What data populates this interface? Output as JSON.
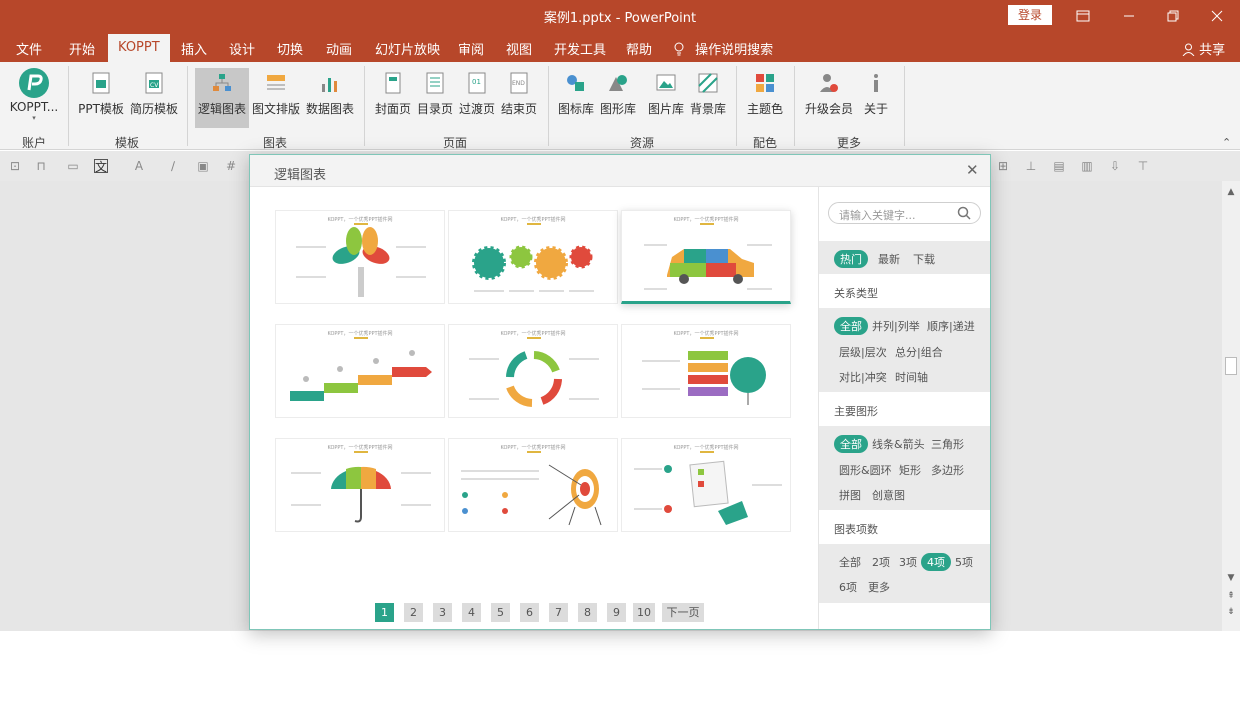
{
  "window": {
    "title": "案例1.pptx  -  PowerPoint",
    "login": "登录"
  },
  "menu": {
    "items": [
      "文件",
      "开始",
      "KOPPT",
      "插入",
      "设计",
      "切换",
      "动画",
      "幻灯片放映",
      "审阅",
      "视图",
      "开发工具",
      "帮助"
    ],
    "tell_me": "操作说明搜索",
    "share": "共享"
  },
  "ribbon": {
    "buttons": [
      "KOPPT...",
      "PPT模板",
      "简历模板",
      "逻辑图表",
      "图文排版",
      "数据图表",
      "封面页",
      "目录页",
      "过渡页",
      "结束页",
      "图标库",
      "图形库",
      "图片库",
      "背景库",
      "主题色",
      "升级会员",
      "关于"
    ],
    "groups": [
      "账户",
      "模板",
      "图表",
      "页面",
      "资源",
      "配色",
      "更多"
    ]
  },
  "dialog": {
    "title": "逻辑图表",
    "card_caption": "KOPPT，一个优秀PPT插件网",
    "pager": [
      "1",
      "2",
      "3",
      "4",
      "5",
      "6",
      "7",
      "8",
      "9",
      "10"
    ],
    "next": "下一页",
    "active_page": "1"
  },
  "sidebar": {
    "search_placeholder": "请输入关键字...",
    "sort_tabs": [
      "热门",
      "最新",
      "下载"
    ],
    "relation_title": "关系类型",
    "relation_tags": [
      "全部",
      "并列|列举",
      "顺序|递进",
      "层级|层次",
      "总分|组合",
      "对比|冲突",
      "时间轴"
    ],
    "shape_title": "主要图形",
    "shape_tags": [
      "全部",
      "线条&箭头",
      "三角形",
      "圆形&圆环",
      "矩形",
      "多边形",
      "拼图",
      "创意图"
    ],
    "count_title": "图表项数",
    "count_tags": [
      "全部",
      "2项",
      "3项",
      "4项",
      "5项",
      "6项",
      "更多"
    ]
  },
  "colors": {
    "accent": "#2aa38a",
    "titlebar": "#b7472a"
  }
}
